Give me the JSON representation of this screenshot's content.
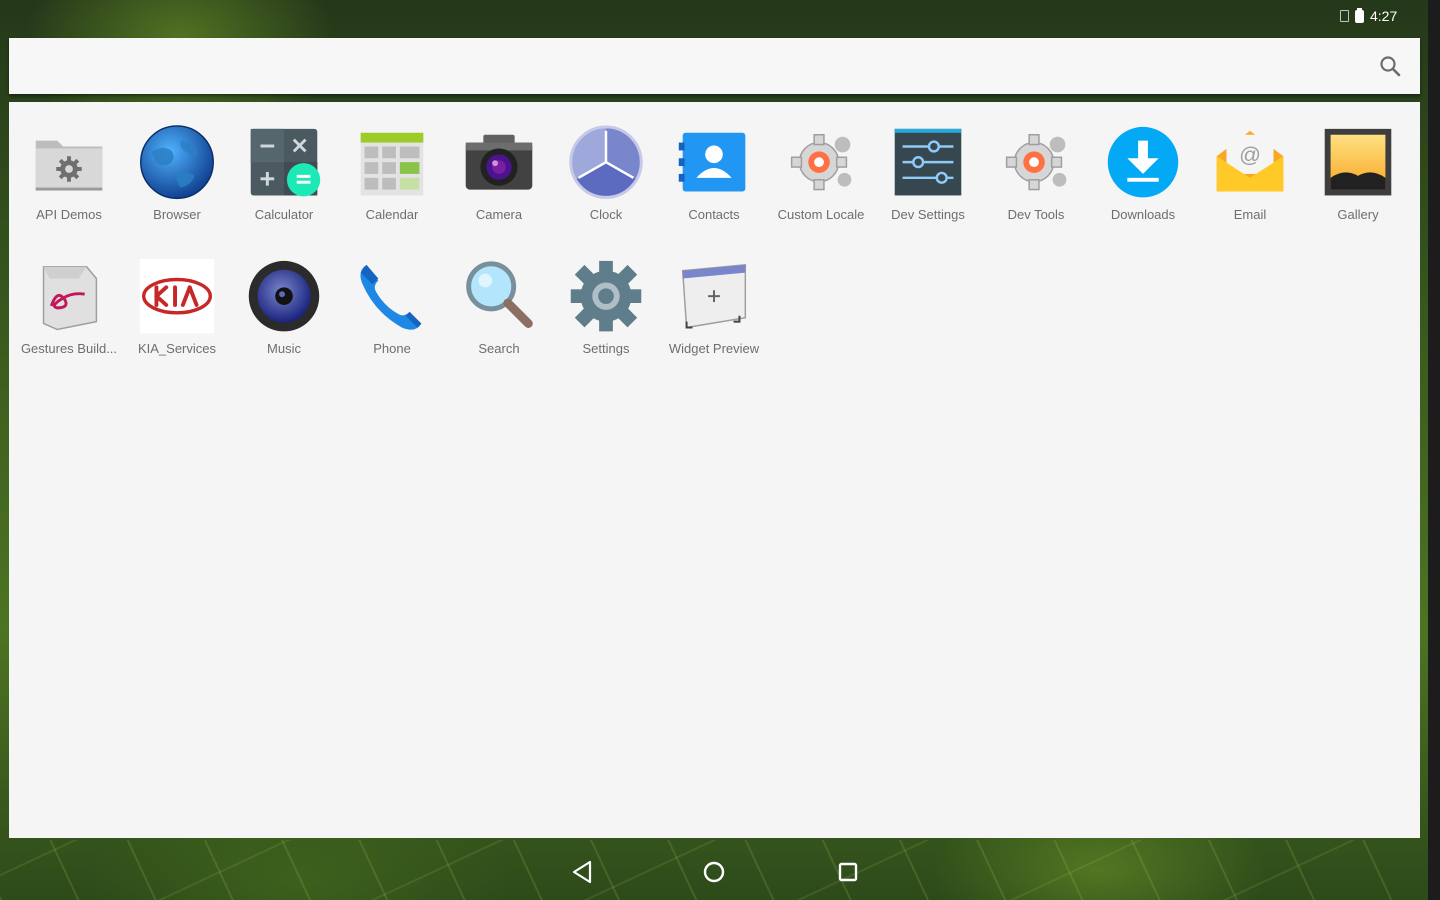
{
  "status_bar": {
    "time": "4:27",
    "icons": [
      "sim-icon",
      "battery-icon"
    ]
  },
  "search": {
    "placeholder": "",
    "icon": "search-icon"
  },
  "apps": [
    {
      "label": "API Demos",
      "icon": "api-demos-icon"
    },
    {
      "label": "Browser",
      "icon": "browser-globe-icon"
    },
    {
      "label": "Calculator",
      "icon": "calculator-icon"
    },
    {
      "label": "Calendar",
      "icon": "calendar-icon"
    },
    {
      "label": "Camera",
      "icon": "camera-icon"
    },
    {
      "label": "Clock",
      "icon": "clock-icon"
    },
    {
      "label": "Contacts",
      "icon": "contacts-icon"
    },
    {
      "label": "Custom Locale",
      "icon": "custom-locale-gear-icon"
    },
    {
      "label": "Dev Settings",
      "icon": "dev-settings-sliders-icon"
    },
    {
      "label": "Dev Tools",
      "icon": "dev-tools-gear-icon"
    },
    {
      "label": "Downloads",
      "icon": "downloads-icon"
    },
    {
      "label": "Email",
      "icon": "email-envelope-icon"
    },
    {
      "label": "Gallery",
      "icon": "gallery-icon"
    },
    {
      "label": "Gestures Build...",
      "icon": "gestures-builder-icon"
    },
    {
      "label": "KIA_Services",
      "icon": "kia-logo-icon"
    },
    {
      "label": "Music",
      "icon": "music-speaker-icon"
    },
    {
      "label": "Phone",
      "icon": "phone-handset-icon"
    },
    {
      "label": "Search",
      "icon": "magnifier-icon"
    },
    {
      "label": "Settings",
      "icon": "settings-gear-icon"
    },
    {
      "label": "Widget Preview",
      "icon": "widget-preview-icon"
    }
  ],
  "navigation": {
    "back_icon": "back-triangle-icon",
    "home_icon": "home-circle-icon",
    "recents_icon": "recents-square-icon"
  },
  "colors": {
    "drawer_bg": "#f5f5f5",
    "label_text": "#6e6e6e",
    "wallpaper": "#3b5d1e"
  }
}
